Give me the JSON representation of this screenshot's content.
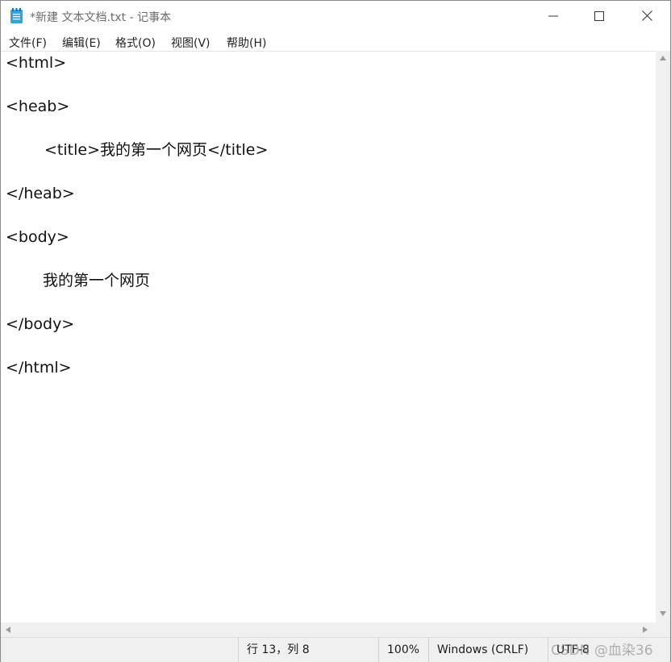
{
  "window": {
    "title": "*新建 文本文档.txt - 记事本"
  },
  "menu": {
    "items": [
      {
        "label": "文件(F)"
      },
      {
        "label": "编辑(E)"
      },
      {
        "label": "格式(O)"
      },
      {
        "label": "视图(V)"
      },
      {
        "label": "帮助(H)"
      }
    ]
  },
  "editor": {
    "lines": [
      "<html>",
      "",
      "<heab>",
      "",
      "\t<title>我的第一个网页</title>",
      "",
      "</heab>",
      "",
      "<body>",
      "",
      "\t我的第一个网页",
      "",
      "</body>",
      "",
      "</html>"
    ]
  },
  "status": {
    "position": "行 13，列 8",
    "zoom": "100%",
    "line_ending": "Windows (CRLF)",
    "encoding": "UTF-8"
  },
  "watermark": "CSDN @血染36",
  "icons": {
    "app": "notepad-icon",
    "minimize": "minimize-icon",
    "maximize": "maximize-icon",
    "close": "close-icon"
  },
  "colors": {
    "chrome": "#f0f0f0",
    "icon_blue": "#3aa0d8"
  }
}
